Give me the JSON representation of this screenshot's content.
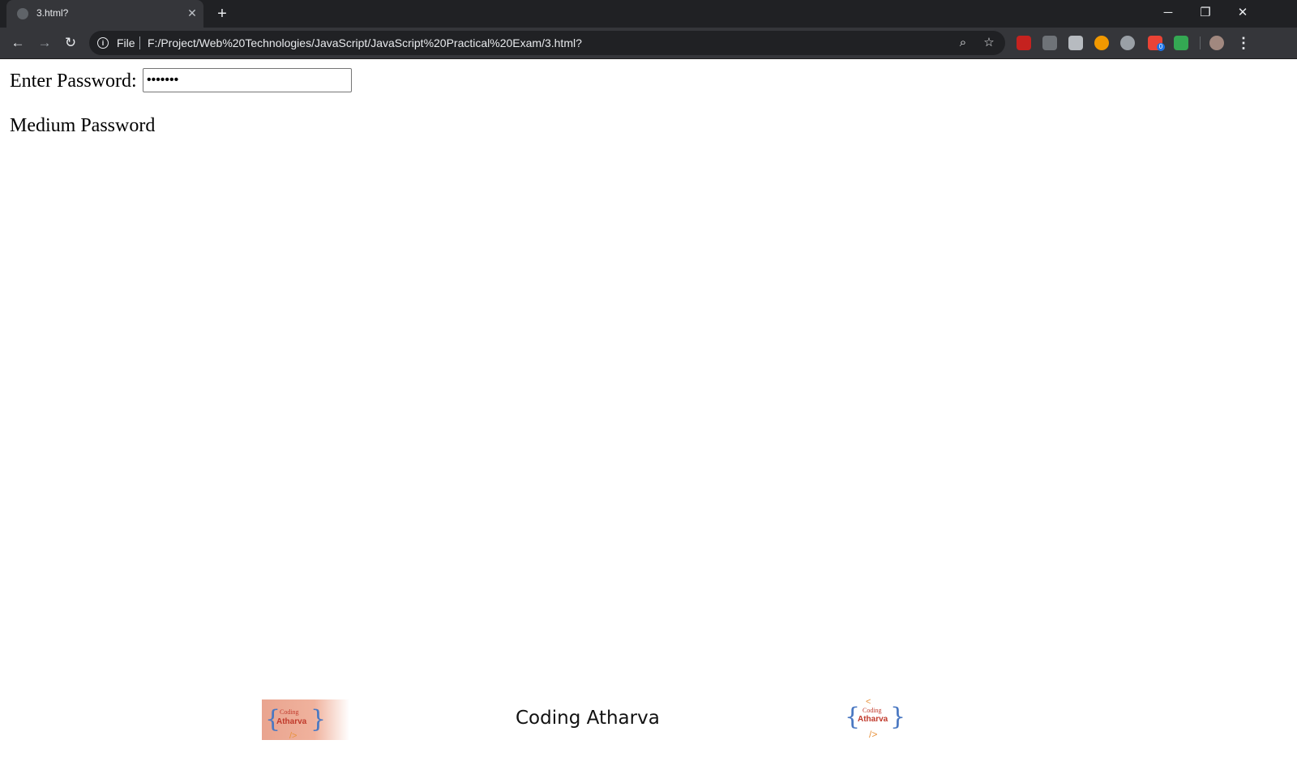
{
  "browser": {
    "tab": {
      "title": "3.html?"
    },
    "omnibox": {
      "scheme_label": "File",
      "url": "F:/Project/Web%20Technologies/JavaScript/JavaScript%20Practical%20Exam/3.html?"
    },
    "extensions_badge": "0"
  },
  "page": {
    "password_label": "Enter Password:",
    "password_value": "•••••••",
    "strength_text": "Medium Password"
  },
  "branding": {
    "text": "Coding Atharva",
    "logo_top": "Coding",
    "logo_main": "Atharva",
    "logo_open": "<",
    "logo_close": "/>"
  },
  "colors": {
    "chrome_dark": "#202124",
    "chrome_toolbar": "#35363a",
    "logo_accent": "#4a78c2",
    "logo_red": "#d93025",
    "logo_orange": "#e8923c"
  }
}
